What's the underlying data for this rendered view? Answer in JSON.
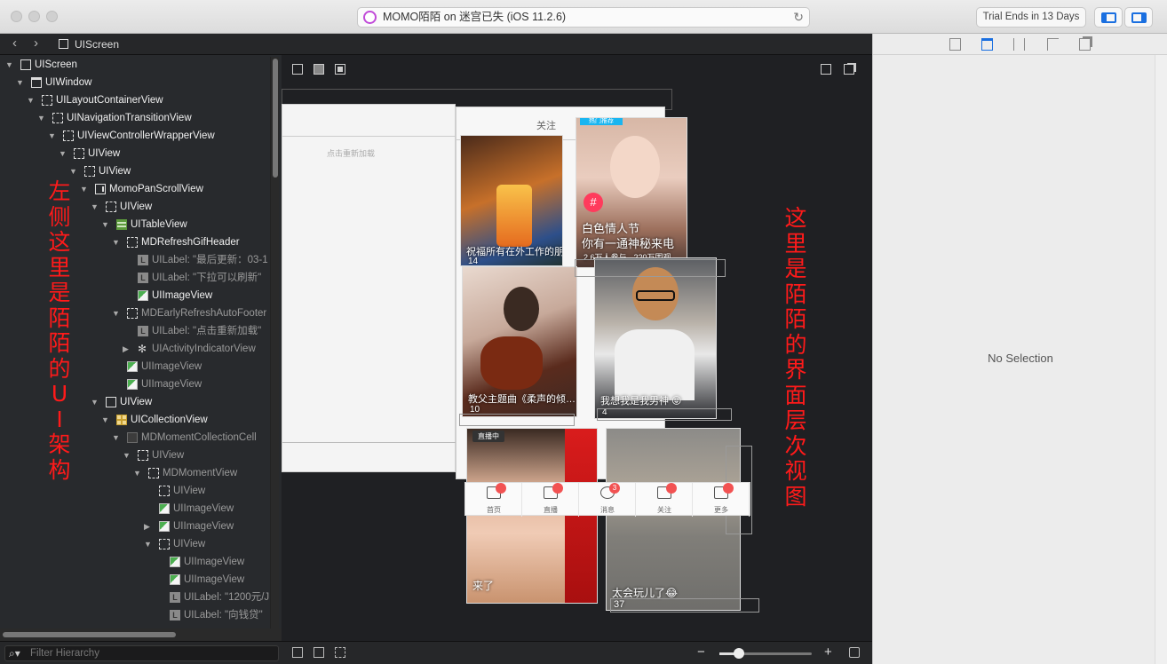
{
  "window": {
    "address": "MOMO陌陌 on 迷宫已失 (iOS 11.2.6)",
    "trial": "Trial Ends in 13 Days"
  },
  "jumpbar": {
    "crumb": "UIScreen"
  },
  "hierarchy": [
    {
      "indent": 0,
      "disc": "▼",
      "icon": "solid",
      "label": "UIScreen"
    },
    {
      "indent": 1,
      "disc": "▼",
      "icon": "window",
      "label": "UIWindow"
    },
    {
      "indent": 2,
      "disc": "▼",
      "icon": "dash",
      "label": "UILayoutContainerView"
    },
    {
      "indent": 3,
      "disc": "▼",
      "icon": "dash",
      "label": "UINavigationTransitionView"
    },
    {
      "indent": 4,
      "disc": "▼",
      "icon": "dash",
      "label": "UIViewControllerWrapperView"
    },
    {
      "indent": 5,
      "disc": "▼",
      "icon": "dash",
      "label": "UIView"
    },
    {
      "indent": 6,
      "disc": "▼",
      "icon": "dash",
      "label": "UIView"
    },
    {
      "indent": 7,
      "disc": "▼",
      "icon": "scroll",
      "label": "MomoPanScrollView"
    },
    {
      "indent": 8,
      "disc": "▼",
      "icon": "dash",
      "label": "UIView"
    },
    {
      "indent": 9,
      "disc": "▼",
      "icon": "table",
      "label": "UITableView"
    },
    {
      "indent": 10,
      "disc": "▼",
      "icon": "dash",
      "label": "MDRefreshGifHeader"
    },
    {
      "indent": 11,
      "disc": "",
      "icon": "label",
      "label": "UILabel: \"最后更新：03-1",
      "dim": true
    },
    {
      "indent": 11,
      "disc": "",
      "icon": "label",
      "label": "UILabel: \"下拉可以刷新\"",
      "dim": true
    },
    {
      "indent": 11,
      "disc": "",
      "icon": "image",
      "label": "UIImageView"
    },
    {
      "indent": 10,
      "disc": "▼",
      "icon": "dash",
      "label": "MDEarlyRefreshAutoFooter",
      "dim": true
    },
    {
      "indent": 11,
      "disc": "",
      "icon": "label",
      "label": "UILabel: \"点击重新加载\"",
      "dim": true
    },
    {
      "indent": 11,
      "disc": "▶",
      "icon": "activity",
      "label": "UIActivityIndicatorView",
      "dim": true
    },
    {
      "indent": 10,
      "disc": "",
      "icon": "image",
      "label": "UIImageView",
      "dim": true
    },
    {
      "indent": 10,
      "disc": "",
      "icon": "image",
      "label": "UIImageView",
      "dim": true
    },
    {
      "indent": 8,
      "disc": "▼",
      "icon": "solid",
      "label": "UIView"
    },
    {
      "indent": 9,
      "disc": "▼",
      "icon": "coll",
      "label": "UICollectionView"
    },
    {
      "indent": 10,
      "disc": "▼",
      "icon": "cell",
      "label": "MDMomentCollectionCell",
      "dim": true
    },
    {
      "indent": 11,
      "disc": "▼",
      "icon": "dash",
      "label": "UIView",
      "dim": true
    },
    {
      "indent": 12,
      "disc": "▼",
      "icon": "dash",
      "label": "MDMomentView",
      "dim": true
    },
    {
      "indent": 13,
      "disc": "",
      "icon": "dash",
      "label": "UIView",
      "dim": true
    },
    {
      "indent": 13,
      "disc": "",
      "icon": "image",
      "label": "UIImageView",
      "dim": true
    },
    {
      "indent": 13,
      "disc": "▶",
      "icon": "image",
      "label": "UIImageView",
      "dim": true
    },
    {
      "indent": 13,
      "disc": "▼",
      "icon": "dash",
      "label": "UIView",
      "dim": true
    },
    {
      "indent": 14,
      "disc": "",
      "icon": "image",
      "label": "UIImageView",
      "dim": true
    },
    {
      "indent": 14,
      "disc": "",
      "icon": "image",
      "label": "UIImageView",
      "dim": true
    },
    {
      "indent": 14,
      "disc": "",
      "icon": "label",
      "label": "UILabel: \"1200元/J",
      "dim": true
    },
    {
      "indent": 14,
      "disc": "",
      "icon": "label",
      "label": "UILabel: \"向钱贷\"",
      "dim": true
    }
  ],
  "filter": {
    "placeholder": "Filter Hierarchy"
  },
  "annotations": {
    "left": [
      "左",
      "侧",
      "这",
      "里",
      "是",
      "陌",
      "陌",
      "的",
      "U",
      "I",
      "架",
      "构"
    ],
    "right": [
      "这",
      "里",
      "是",
      "陌",
      "陌",
      "的",
      "界",
      "面",
      "层",
      "次",
      "视",
      "图"
    ]
  },
  "app": {
    "tab_follow": "关注",
    "reload_text": "点击重新加载",
    "hot_badge": "热门推荐",
    "live_badge": "直播中",
    "cards": [
      {
        "caption": "祝福所有在外工作的朋…",
        "count": "14"
      },
      {
        "caption": "白色情人节",
        "caption2": "你有一通神秘来电",
        "count": "2.6万人参与 · 220万围观"
      },
      {
        "caption": "教父主题曲《柔声的倾…",
        "count": "10"
      },
      {
        "caption": "我想我是我男神 😛",
        "count": "4"
      },
      {
        "caption": "来了",
        "count": ""
      },
      {
        "caption": "太会玩儿了😂",
        "count": "37"
      }
    ],
    "tabbar": [
      {
        "label": "首页",
        "badge": ""
      },
      {
        "label": "直播",
        "badge": ""
      },
      {
        "label": "消息",
        "badge": "3"
      },
      {
        "label": "关注",
        "badge": ""
      },
      {
        "label": "更多",
        "badge": ""
      }
    ]
  },
  "inspector": {
    "empty": "No Selection"
  },
  "colors": {
    "annotation": "#ff1a1a",
    "accent": "#1a6fe0",
    "badge": "#f25252"
  }
}
